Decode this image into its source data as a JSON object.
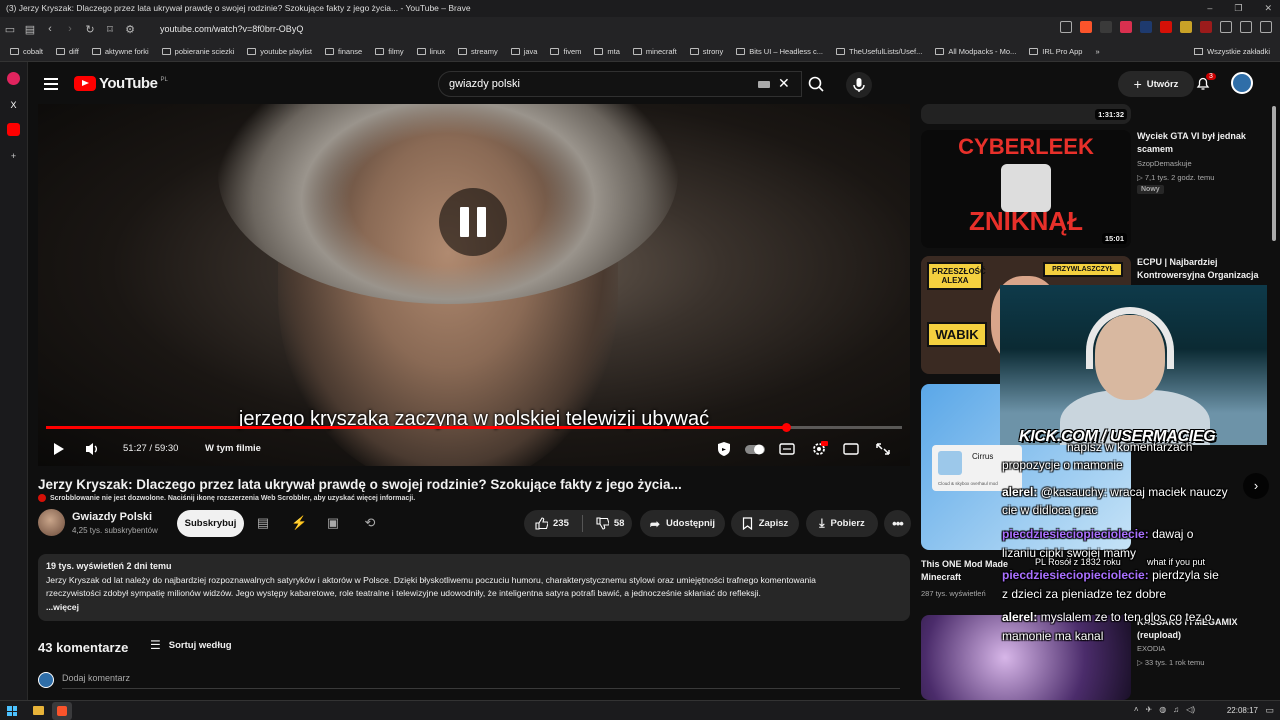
{
  "window": {
    "title": "(3) Jerzy Kryszak: Dlaczego przez lata ukrywał prawdę o swojej rodzinie? Szokujące fakty z jego życia... - YouTube – Brave",
    "url": "youtube.com/watch?v=8f0brr-OByQ"
  },
  "bookmarks": {
    "items": [
      "cobalt",
      "diff",
      "aktywne forki",
      "pobieranie sciezki",
      "youtube playlist",
      "finanse",
      "filmy",
      "linux",
      "streamy",
      "java",
      "fivem",
      "mta",
      "minecraft",
      "strony",
      "Bits UI – Headless c...",
      "TheUsefulLists/Usef...",
      "All Modpacks - Mo...",
      "IRL Pro App"
    ],
    "more": "»",
    "all_bookmarks": "Wszystkie zakładki"
  },
  "header": {
    "logo_text": "YouTube",
    "country": "PL",
    "search_value": "gwiazdy polski",
    "create_label": "Utwórz",
    "notifications_count": "3"
  },
  "player": {
    "subtitle": "jerzego kryszaka zaczyna w polskiej telewizji ubywać",
    "time": "51:27 / 59:30",
    "chapter": "W tym filmie",
    "progress": 0.865
  },
  "video": {
    "title": "Jerzy Kryszak: Dlaczego przez lata ukrywał prawdę o swojej rodzinie? Szokujące fakty z jego życia...",
    "scrobble_notice": "Scrobblowanie nie jest dozwolone. Naciśnij ikonę rozszerzenia Web Scrobbler, aby uzyskać więcej informacji.",
    "channel_name": "Gwiazdy Polski",
    "subscribers": "4,25 tys. subskrybentów",
    "subscribe_label": "Subskrybuj",
    "likes": "235",
    "dislikes": "58",
    "share_label": "Udostępnij",
    "save_label": "Zapisz",
    "download_label": "Pobierz"
  },
  "description": {
    "stats": "19 tys. wyświetleń  2 dni temu",
    "text_line1": "Jerzy Kryszak od lat należy do najbardziej rozpoznawalnych satyryków i aktorów w Polsce. Dzięki błyskotliwemu poczuciu humoru, charakterystycznemu stylowi oraz umiejętności trafnego komentowania",
    "text_line2": "rzeczywistości zdobył sympatię milionów widzów. Jego występy kabaretowe, role teatralne i telewizyjne udowodniły, że inteligentna satyra potrafi bawić, a jednocześnie skłaniać do refleksji.",
    "more_label": "...więcej"
  },
  "comments": {
    "heading": "43 komentarze",
    "sort_label": "Sortuj według",
    "add_placeholder": "Dodaj komentarz"
  },
  "sidebar_videos": [
    {
      "duration": "1:31:32"
    },
    {
      "title": "Wyciek GTA VI był jednak scamem",
      "channel": "SzopDemaskuje",
      "meta": "7,1 tys.  2 godz. temu",
      "badge": "Nowy",
      "duration": "15:01",
      "thumb_text_top": "CYBERLEEK",
      "thumb_text_bottom": "ZNIKNĄŁ"
    },
    {
      "title": "ECPU | Najbardziej Kontrowersyjna Organizacja",
      "thumb_label_1": "PRZESZŁOŚĆ ALEXA",
      "thumb_label_2": "WABIK",
      "thumb_label_3": "PRZYWLASZCZYŁ"
    },
    {
      "title": "This ONE Mod Made Minecraft",
      "meta": "287 tys. wyświetleń"
    },
    {
      "title": "KASSAKO I I MEGAMIX (reupload)",
      "channel": "EXODIA",
      "meta": "33 tys.  1 rok temu"
    }
  ],
  "overlay": {
    "brand": "KICK.COM / USERMACIEG",
    "ad_title": "Cirrus",
    "ad_sub": "Cloud & skybox overhaul mod",
    "chat": [
      {
        "user": "",
        "text": "napisz w komentarzach"
      },
      {
        "user": "",
        "text": "propozycje o mamonie"
      },
      {
        "user": "alerel:",
        "text": "@kasauchy: wracaj maciek nauczy"
      },
      {
        "user": "",
        "text": "cie w didloca grac"
      },
      {
        "user": "piecdziesieciopieciolecie:",
        "text": "dawaj o"
      },
      {
        "user": "",
        "text": "lizaniu cipki swojej mamy"
      },
      {
        "user": "",
        "text": "PL Rosół z 1832 roku"
      },
      {
        "user": "piecdziesieciopieciolecie:",
        "text": "pierdzyla sie"
      },
      {
        "user": "",
        "text": "what if you put"
      },
      {
        "user": "",
        "text": "z dzieci za pieniadze tez dobre"
      },
      {
        "user": "alerel:",
        "text": "myslalem ze to ten glos co tez o"
      },
      {
        "user": "",
        "text": "mamonie ma kanal"
      }
    ]
  },
  "taskbar": {
    "time": "22:08:17"
  },
  "colors": {
    "accent": "#ff0000",
    "background": "#0f0f0f",
    "pill": "#272727",
    "kick_purple": "#a970ff"
  }
}
